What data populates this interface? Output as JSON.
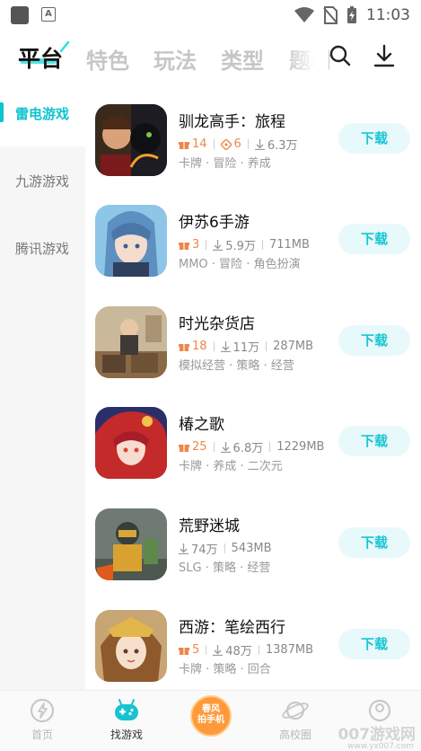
{
  "status_bar": {
    "time": "11:03"
  },
  "top_tabs": [
    {
      "label": "平台",
      "active": true
    },
    {
      "label": "特色",
      "active": false
    },
    {
      "label": "玩法",
      "active": false
    },
    {
      "label": "类型",
      "active": false
    },
    {
      "label": "题材",
      "active": false
    }
  ],
  "toolbar": {
    "search_icon": "search-icon",
    "download_icon": "download-icon"
  },
  "sidebar": {
    "items": [
      {
        "label": "雷电游戏",
        "active": true
      },
      {
        "label": "九游游戏",
        "active": false
      },
      {
        "label": "腾讯游戏",
        "active": false
      }
    ]
  },
  "games": [
    {
      "name": "驯龙高手：旅程",
      "gift": "14",
      "coupon": "6",
      "downloads": "6.3万",
      "size": "",
      "tags": "卡牌 · 冒险 · 养成",
      "button": "下载"
    },
    {
      "name": "伊苏6手游",
      "gift": "3",
      "coupon": "",
      "downloads": "5.9万",
      "size": "711MB",
      "tags": "MMO · 冒险 · 角色扮演",
      "button": "下载"
    },
    {
      "name": "时光杂货店",
      "gift": "18",
      "coupon": "",
      "downloads": "11万",
      "size": "287MB",
      "tags": "模拟经营 · 策略 · 经营",
      "button": "下载"
    },
    {
      "name": "椿之歌",
      "gift": "25",
      "coupon": "",
      "downloads": "6.8万",
      "size": "1229MB",
      "tags": "卡牌 · 养成 · 二次元",
      "button": "下载"
    },
    {
      "name": "荒野迷城",
      "gift": "",
      "coupon": "",
      "downloads": "74万",
      "size": "543MB",
      "tags": "SLG · 策略 · 经营",
      "button": "下载"
    },
    {
      "name": "西游：笔绘西行",
      "gift": "5",
      "coupon": "",
      "downloads": "48万",
      "size": "1387MB",
      "tags": "卡牌 · 策略 · 回合",
      "button": "下载"
    }
  ],
  "bottom_nav": {
    "items": [
      {
        "label": "首页",
        "icon": "home-icon",
        "active": false
      },
      {
        "label": "找游戏",
        "icon": "gamepad-icon",
        "active": true
      },
      {
        "label": "",
        "icon": "campus-event-icon",
        "active": false
      },
      {
        "label": "高校圈",
        "icon": "planet-icon",
        "active": false
      },
      {
        "label": "",
        "icon": "profile-icon",
        "active": false
      }
    ],
    "center_badge_line1": "春风",
    "center_badge_line2": "拍手机"
  },
  "watermark": {
    "text": "007游戏网",
    "sub": "www.yx007.com"
  },
  "colors": {
    "accent": "#0dc3cf",
    "download_bg": "#e8f9fb",
    "gift_orange": "#f0864a"
  }
}
